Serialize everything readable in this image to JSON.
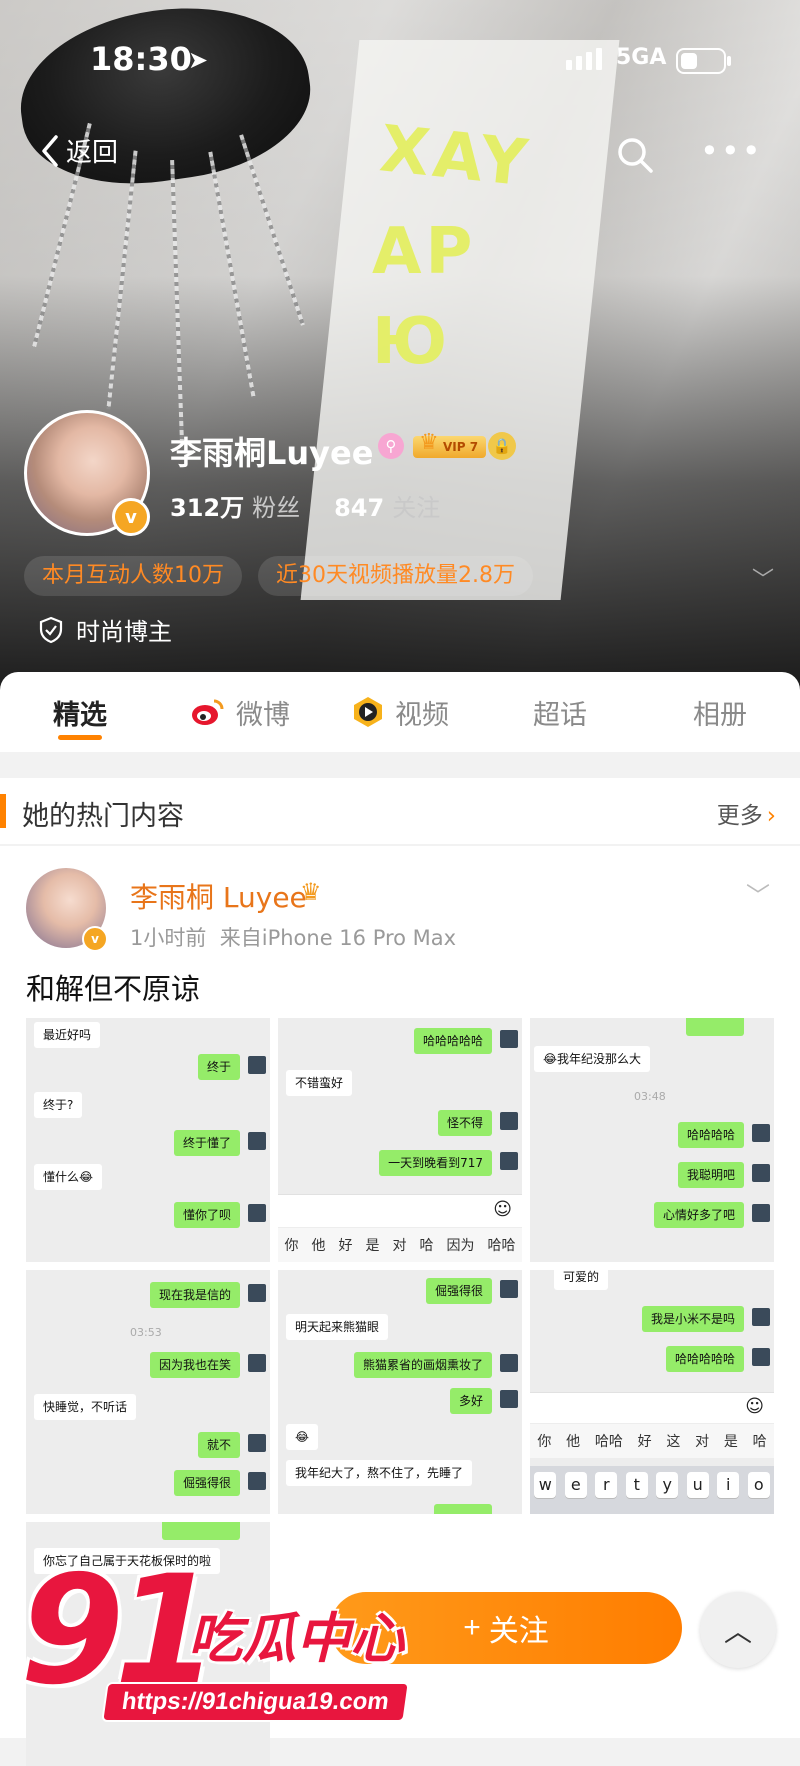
{
  "status_bar": {
    "time": "18:30",
    "network": "5GA"
  },
  "nav": {
    "back_label": "返回"
  },
  "profile": {
    "name": "李雨桐Luyee",
    "vip": "VIP 7",
    "fans_count": "312万",
    "fans_label": "粉丝",
    "following_count": "847",
    "following_label": "关注",
    "pills": [
      "本月互动人数10万",
      "近30天视频播放量2.8万"
    ],
    "tag": "时尚博主",
    "shirt_text": [
      "XAY",
      "AP",
      "Ю"
    ]
  },
  "tabs": [
    {
      "label": "精选",
      "icon": ""
    },
    {
      "label": "微博",
      "icon": "weibo-icon"
    },
    {
      "label": "视频",
      "icon": "video-icon"
    },
    {
      "label": "超话",
      "icon": ""
    },
    {
      "label": "相册",
      "icon": ""
    }
  ],
  "section": {
    "title": "她的热门内容",
    "more": "更多"
  },
  "post": {
    "user": "李雨桐 Luyee",
    "time": "1小时前",
    "source": "来自iPhone 16 Pro Max",
    "text": "和解但不原谅"
  },
  "chats": {
    "c1": [
      "最近好吗",
      "终于",
      "终于?",
      "终于懂了",
      "懂什么😂",
      "懂你了呗"
    ],
    "c2": [
      "哈哈哈哈哈",
      "不错蛮好",
      "怪不得",
      "一天到晚看到717"
    ],
    "c2_kb": [
      "你",
      "他",
      "好",
      "是",
      "对",
      "哈",
      "因为",
      "哈哈"
    ],
    "c3": [
      "😂我年纪没那么大",
      "03:48",
      "哈哈哈哈",
      "我聪明吧",
      "心情好多了吧"
    ],
    "c4": [
      "现在我是信的",
      "03:53",
      "因为我也在笑",
      "快睡觉，不听话",
      "就不",
      "倔强得很"
    ],
    "c5": [
      "倔强得很",
      "明天起来熊猫眼",
      "熊猫累省的画烟熏妆了",
      "多好",
      "😂",
      "我年纪大了，熬不住了，先睡了"
    ],
    "c6": [
      "可爱的",
      "我是小米不是吗",
      "哈哈哈哈哈"
    ],
    "c6_kb": [
      "你",
      "他",
      "哈哈",
      "好",
      "这",
      "对",
      "是",
      "哈"
    ],
    "c6_keys": [
      "w",
      "e",
      "r",
      "t",
      "y",
      "u",
      "i",
      "o"
    ],
    "c7": [
      "你忘了自己属于天花板保时的啦"
    ]
  },
  "bottom": {
    "follow": "关注"
  },
  "watermark": {
    "number": "91",
    "brand": "吃瓜中心",
    "url": "https://91chigua19.com"
  },
  "colors": {
    "accent": "#ff8200",
    "username": "#e8751a",
    "bubble_green": "#95ec69",
    "watermark_red": "#e8163e"
  }
}
